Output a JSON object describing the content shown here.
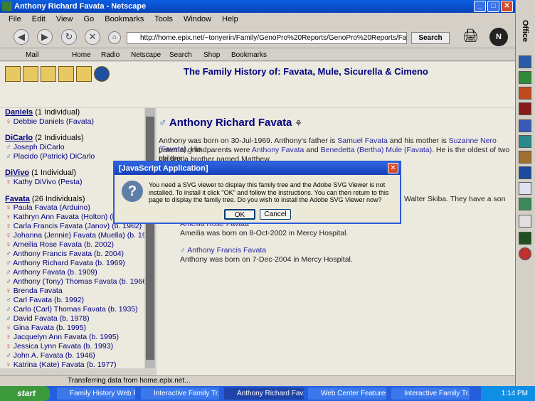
{
  "window": {
    "title": "Anthony Richard Favata - Netscape"
  },
  "menu": [
    "File",
    "Edit",
    "View",
    "Go",
    "Bookmarks",
    "Tools",
    "Window",
    "Help"
  ],
  "nav": {
    "url": "http://home.epix.net/~tonyerin/Family/GenoPro%20Reports/GenoPro%20Reports/Favata,%20Mule,%",
    "search_label": "Search"
  },
  "personal_toolbar": [
    "Mail",
    "Home",
    "Radio",
    "Netscape",
    "Search",
    "Shop",
    "Bookmarks"
  ],
  "banner": {
    "title": "The Family History of:  Favata, Mule, Sicurella & Cimeno"
  },
  "left_panel": {
    "families": [
      {
        "name": "Daniels",
        "count": "(1 Individual)",
        "people": [
          {
            "sym": "female",
            "name": "Debbie Daniels (Favata)"
          }
        ]
      },
      {
        "name": "DiCarlo",
        "count": "(2 Individuals)",
        "people": [
          {
            "sym": "male",
            "name": "Joseph DiCarlo"
          },
          {
            "sym": "male",
            "name": "Placido (Patrick) DiCarlo"
          }
        ]
      },
      {
        "name": "DiVivo",
        "count": "(1 Individual)",
        "people": [
          {
            "sym": "female",
            "name": "Kathy DiVivo (Pesta)"
          }
        ]
      },
      {
        "name": "Favata",
        "count": "(26 Individuals)",
        "people": [
          {
            "sym": "female",
            "name": "Paula Favata (Arduino)"
          },
          {
            "sym": "female",
            "name": "Kathryn Ann Favata (Holton) (b."
          },
          {
            "sym": "female",
            "name": "Carla Francis Favata (Janov) (b. 1962)"
          },
          {
            "sym": "female",
            "name": "Johanna (Jennie) Favata (Muella) (b. 1914)"
          },
          {
            "sym": "female",
            "name": "Ameilia Rose Favata (b. 2002)"
          },
          {
            "sym": "male",
            "name": "Anthony Francis Favata (b. 2004)"
          },
          {
            "sym": "male",
            "name": "Anthony Richard Favata (b. 1969)"
          },
          {
            "sym": "male",
            "name": "Anthony Favata (b. 1909)"
          },
          {
            "sym": "male",
            "name": "Anthony (Tony) Thomas Favata (b. 1966)"
          },
          {
            "sym": "female",
            "name": "Brenda Favata"
          },
          {
            "sym": "male",
            "name": "Carl Favata (b. 1992)"
          },
          {
            "sym": "male",
            "name": "Carlo (Carl) Thomas Favata (b. 1935)"
          },
          {
            "sym": "male",
            "name": "David Favata (b. 1978)"
          },
          {
            "sym": "female",
            "name": "Gina Favata (b. 1995)"
          },
          {
            "sym": "female",
            "name": "Jacquelyn Ann Favata (b. 1995)"
          },
          {
            "sym": "female",
            "name": "Jessica Lynn Favata (b. 1993)"
          },
          {
            "sym": "male",
            "name": "John A. Favata (b. 1946)"
          },
          {
            "sym": "female",
            "name": "Katrina (Kate) Favata (b. 1977)"
          }
        ]
      }
    ]
  },
  "main": {
    "heading": "Anthony Richard Favata",
    "bio_line1": "Anthony was born on 30-Jul-1969.  Anthony's father is ",
    "father": "Samuel Favata",
    "bio_mid1": " and his mother is ",
    "mother": "Suzanne Nero (Favata)",
    "bio_end1": ".  His",
    "bio_line2a": "paternal grandparents were ",
    "gf": "Anthony Favata",
    "and": " and ",
    "gm": "Benedetta (Bertha) Mule (Favata)",
    "bio_line2b": ".  He is the oldest of two children.",
    "bio_line3": "He has a brother named Matthew.",
    "spouse_frag": "Walter Skiba.  They have a son",
    "child1_frag": "Ameilia Rose Favata",
    "child1_born": "Ameilia was born on 8-Oct-2002 in Mercy Hospital.",
    "child2_name": "Anthony Francis Favata",
    "child2_born": "Anthony was born on 7-Dec-2004 in Mercy Hospital."
  },
  "status": {
    "text": "Transferring data from home.epix.net..."
  },
  "sidebar": {
    "label": "Office"
  },
  "taskbar": {
    "start": "start",
    "items": [
      "Family History Web P...",
      "Interactive Family Tr...",
      "Anthony Richard Fav...",
      "Web Center Features...",
      "Interactive Family Tr..."
    ],
    "time": "1:14 PM"
  },
  "dialog": {
    "title": "[JavaScript Application]",
    "message": "You need a SVG viewer to display this family tree and the Adobe SVG Viewer is not installed. To install it click \"OK\" and follow the instructions. You can then return to this page to display the family tree. Do you wish to install the Adobe SVG Viewer now?",
    "ok": "OK",
    "cancel": "Cancel",
    "icon": "?"
  }
}
